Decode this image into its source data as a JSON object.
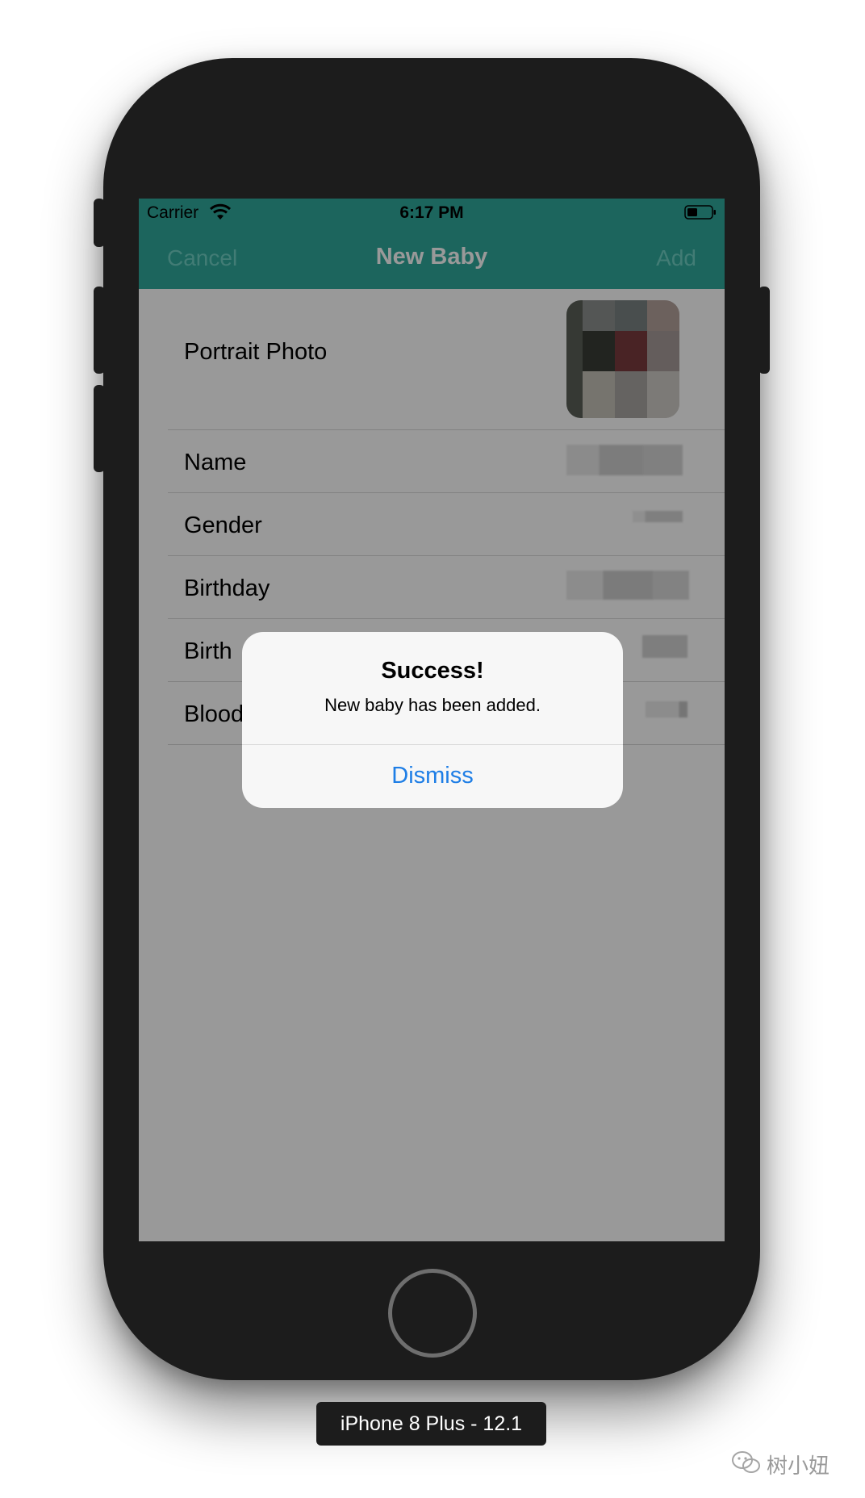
{
  "status_bar": {
    "carrier": "Carrier",
    "time": "6:17 PM"
  },
  "nav_bar": {
    "cancel_label": "Cancel",
    "title": "New Baby",
    "add_label": "Add"
  },
  "form": {
    "rows": [
      {
        "label": "Portrait Photo"
      },
      {
        "label": "Name"
      },
      {
        "label": "Gender"
      },
      {
        "label": "Birthday"
      },
      {
        "label": "Birth"
      },
      {
        "label": "Blood"
      }
    ]
  },
  "alert": {
    "title": "Success!",
    "message": "New baby has been added.",
    "button_label": "Dismiss"
  },
  "device_label": "iPhone 8 Plus - 12.1",
  "watermark": "树小妞",
  "colors": {
    "nav_teal": "#2fa89b",
    "alert_button_blue": "#1e7ee6",
    "device_body": "#1c1c1c"
  }
}
